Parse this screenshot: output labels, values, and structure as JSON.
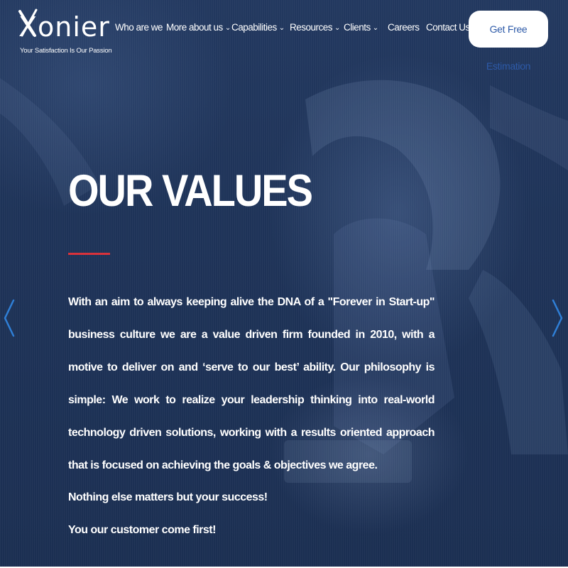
{
  "header": {
    "logo_text": "Xonier",
    "tagline": "Your Satisfaction Is Our Passion",
    "nav": [
      {
        "label": "Who are we",
        "dropdown": false
      },
      {
        "label": "More about us",
        "dropdown": true
      },
      {
        "label": "Capabilities",
        "dropdown": true
      },
      {
        "label": "Resources",
        "dropdown": true
      },
      {
        "label": "Clients",
        "dropdown": true
      },
      {
        "label": "Careers",
        "dropdown": false
      },
      {
        "label": "Contact Us",
        "dropdown": false
      }
    ],
    "cta_label": "Get Free Estimation"
  },
  "hero": {
    "title": "OUR VALUES",
    "paragraph": "With an aim to always keeping alive the DNA of a \"Forever in Start-up\" business culture we are a value driven firm founded in 2010, with a motive to deliver on and ‘serve to our best’ ability. Our philosophy is simple: We work to realize your leadership thinking into real-world technology driven solutions, working with a results oriented approach that is focused on achieving the goals & objectives we agree.",
    "line1": "Nothing else matters but your success!",
    "line2": "You our customer come first!"
  },
  "icons": {
    "prev_arrow": "chevron-left-icon",
    "next_arrow": "chevron-right-icon",
    "dropdown_caret": "chevron-down-icon"
  },
  "colors": {
    "background": "#1e3358",
    "accent_rule": "#d9323b",
    "cta_text": "#2d5aa8",
    "arrow": "#2f7fd6"
  }
}
